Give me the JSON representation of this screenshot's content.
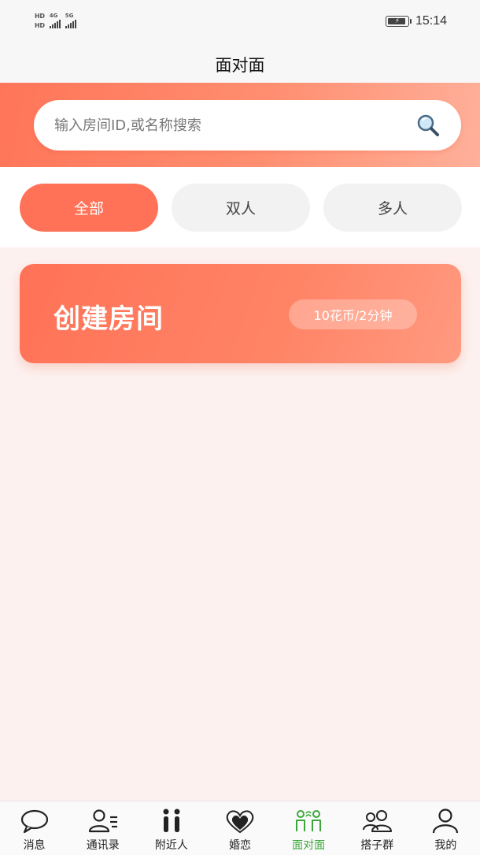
{
  "status_bar": {
    "hd1": "HD",
    "hd2": "HD",
    "net1": "4G",
    "net2": "5G",
    "time": "15:14"
  },
  "header": {
    "title": "面对面"
  },
  "search": {
    "placeholder": "输入房间ID,或名称搜索",
    "value": ""
  },
  "filters": [
    {
      "label": "全部",
      "active": true
    },
    {
      "label": "双人",
      "active": false
    },
    {
      "label": "多人",
      "active": false
    }
  ],
  "create_room": {
    "title": "创建房间",
    "price": "10花币/2分钟"
  },
  "bottom_nav": [
    {
      "label": "消息",
      "icon": "chat-bubble-icon"
    },
    {
      "label": "通讯录",
      "icon": "contacts-icon"
    },
    {
      "label": "附近人",
      "icon": "nearby-people-icon"
    },
    {
      "label": "婚恋",
      "icon": "heart-icon"
    },
    {
      "label": "面对面",
      "icon": "face-to-face-icon",
      "active": true
    },
    {
      "label": "搭子群",
      "icon": "group-icon"
    },
    {
      "label": "我的",
      "icon": "profile-icon"
    }
  ],
  "colors": {
    "accent": "#ff7257",
    "active_nav": "#3aa73a",
    "page_bg": "#fdf1ef"
  }
}
